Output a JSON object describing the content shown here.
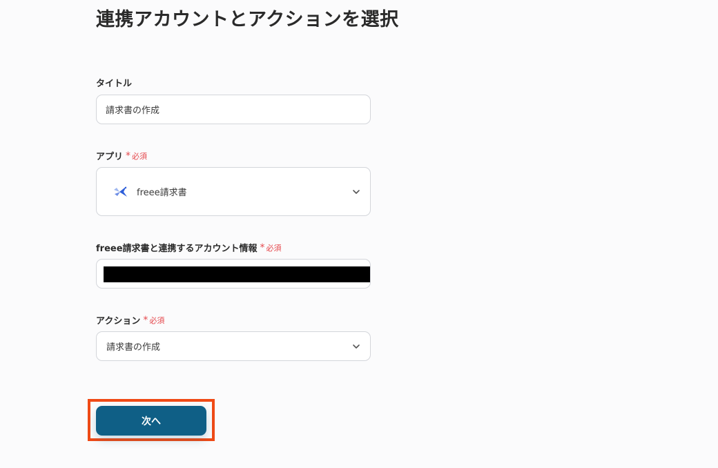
{
  "page": {
    "title": "連携アカウントとアクションを選択"
  },
  "required_mark": "*",
  "required_text": "必須",
  "form": {
    "title_field": {
      "label": "タイトル",
      "value": "請求書の作成"
    },
    "app_field": {
      "label": "アプリ",
      "value": "freee請求書",
      "icon": "freee-invoice-bird-logo"
    },
    "account_field": {
      "label": "freee請求書と連携するアカウント情報"
    },
    "action_field": {
      "label": "アクション",
      "value": "請求書の作成"
    }
  },
  "next_button": {
    "label": "次へ"
  },
  "colors": {
    "primary": "#0f5f86",
    "required": "#e5484d",
    "highlight": "#f04a16"
  }
}
